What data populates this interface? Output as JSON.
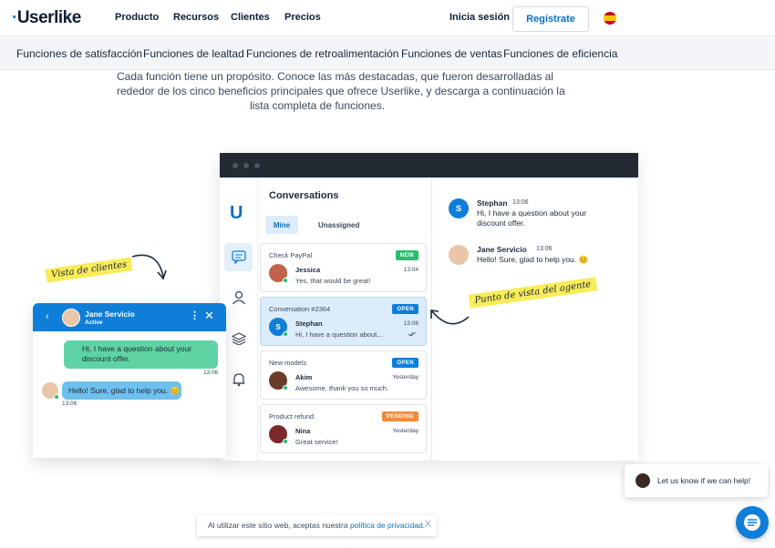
{
  "brand": {
    "logo_text": "Userlike",
    "accent": "#0d6ebd"
  },
  "topnav": {
    "items": [
      "Producto",
      "Recursos",
      "Clientes",
      "Precios"
    ],
    "login": "Inicia sesión",
    "signup": "Regístrate",
    "language_flag": "spain-flag-icon"
  },
  "subnav": {
    "items": [
      "Funciones de satisfacción",
      "Funciones de lealtad",
      "Funciones de retroalimentación",
      "Funciones de ventas",
      "Funciones de eficiencia"
    ]
  },
  "intro": {
    "lines": [
      "Cada función tiene un propósito. Conoce las más destacadas, que fueron desarrolladas al",
      "rededor de los cinco beneficios principales que ofrece Userlike, y descarga a continuación la",
      "lista completa de funciones."
    ]
  },
  "app": {
    "title": "Conversations",
    "tabs": [
      "Mine",
      "Unassigned"
    ],
    "conversations": [
      {
        "subject": "Check PayPal",
        "badge": "NEW",
        "badge_color": "#25c06d",
        "name": "Jessica",
        "time": "13:04",
        "message": "Yes, that would be great!",
        "avatar_color": "#c0634a"
      },
      {
        "subject": "Conversation #2364",
        "badge": "OPEN",
        "badge_color": "#0f7ed8",
        "name": "Stephan",
        "time": "13:06",
        "message": "Hi, I have a question about...",
        "avatar_initial": "S",
        "avatar_color": "#0f7ed8"
      },
      {
        "subject": "New models",
        "badge": "OPEN",
        "badge_color": "#0f7ed8",
        "name": "Akim",
        "time": "Yesterday",
        "message": "Awesome, thank you so much.",
        "avatar_color": "#6b3b2a"
      },
      {
        "subject": "Product refund",
        "badge": "PENDING",
        "badge_color": "#f28a3b",
        "name": "Nina",
        "time": "Yesterday",
        "message": "Great service!",
        "avatar_color": "#7a2a2a"
      }
    ],
    "chat": [
      {
        "name": "Stephan",
        "time": "13:06",
        "message": "Hi, I have a question about your discount offer.",
        "avatar_initial": "S"
      },
      {
        "name": "Jane Servicio",
        "time": "13:06",
        "message": "Hello! Sure, glad to help you. 😊"
      }
    ]
  },
  "widget": {
    "agent_name": "Jane Servicio",
    "status": "Active",
    "outgoing": {
      "text_line1": "Hi, I have a question about your",
      "text_line2": "discount offer.",
      "time": "13:06"
    },
    "incoming": {
      "text": "Hello! Sure, glad to help you. 😊",
      "time": "13:06"
    }
  },
  "annotations": {
    "client_view": "Vista de clientes",
    "agent_view": "Punto de vista del agente"
  },
  "help_prompt": "Let us know if we can help!",
  "cookie": {
    "text": "Al utilizar este sitio web, aceptas nuestra",
    "link": "política de privacidad.",
    "close": "X"
  }
}
